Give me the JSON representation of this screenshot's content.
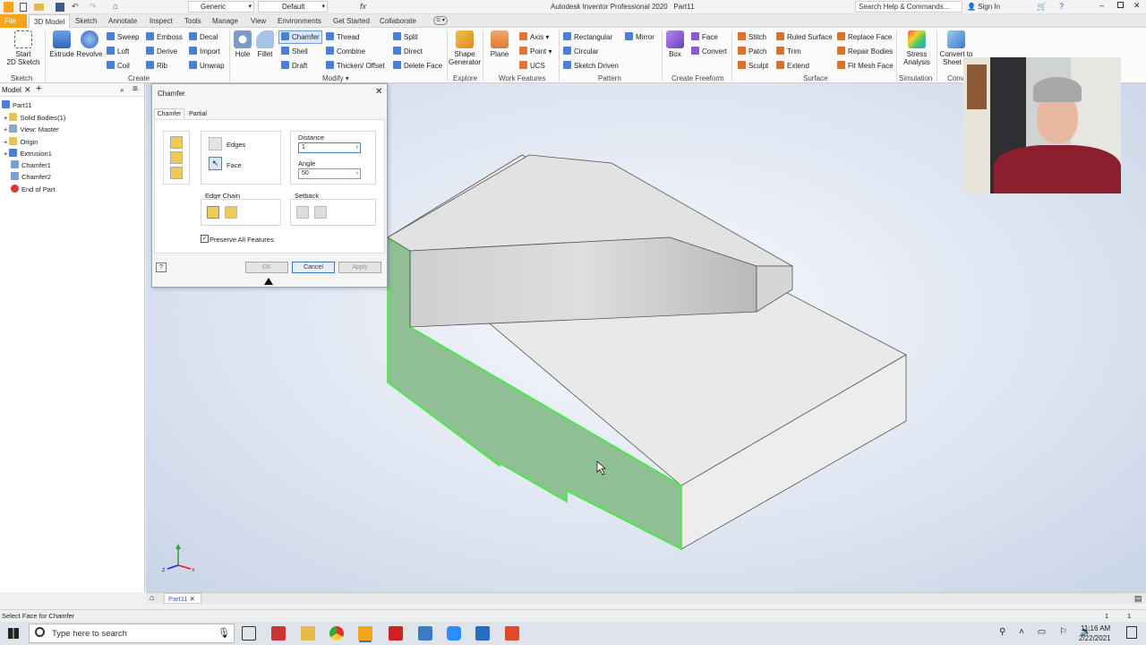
{
  "window": {
    "title": "Autodesk Inventor Professional 2020",
    "doc": "Part11",
    "material": "Generic",
    "appearance": "Default",
    "search_placeholder": "Search Help & Commands...",
    "sign_in": "Sign In"
  },
  "menu": {
    "tabs": [
      "File",
      "3D Model",
      "Sketch",
      "Annotate",
      "Inspect",
      "Tools",
      "Manage",
      "View",
      "Environments",
      "Get Started",
      "Collaborate"
    ]
  },
  "ribbon": {
    "sketch": {
      "start": "Start",
      "start2": "2D Sketch",
      "group": "Sketch"
    },
    "create": {
      "extrude": "Extrude",
      "revolve": "Revolve",
      "sweep": "Sweep",
      "loft": "Loft",
      "coil": "Coil",
      "emboss": "Emboss",
      "derive": "Derive",
      "rib": "Rib",
      "decal": "Decal",
      "import": "Import",
      "unwrap": "Unwrap",
      "group": "Create"
    },
    "modify": {
      "hole": "Hole",
      "fillet": "Fillet",
      "chamfer": "Chamfer",
      "shell": "Shell",
      "draft": "Draft",
      "thread": "Thread",
      "combine": "Combine",
      "thicken": "Thicken/ Offset",
      "split": "Split",
      "direct": "Direct",
      "delete_face": "Delete Face",
      "group": "Modify"
    },
    "explore": {
      "shape": "Shape",
      "shape2": "Generator",
      "group": "Explore"
    },
    "work": {
      "plane": "Plane",
      "axis": "Axis",
      "point": "Point",
      "ucs": "UCS",
      "group": "Work Features"
    },
    "pattern": {
      "rect": "Rectangular",
      "circ": "Circular",
      "sketch_driven": "Sketch Driven",
      "mirror": "Mirror",
      "group": "Pattern"
    },
    "freeform": {
      "box": "Box",
      "face": "Face",
      "convert": "Convert",
      "group": "Create Freeform"
    },
    "surface": {
      "stitch": "Stitch",
      "patch": "Patch",
      "sculpt": "Sculpt",
      "ruled": "Ruled Surface",
      "trim": "Trim",
      "extend": "Extend",
      "replace": "Replace Face",
      "repair": "Repair Bodies",
      "fitmesh": "Fit Mesh Face",
      "group": "Surface"
    },
    "simulation": {
      "stress": "Stress",
      "stress2": "Analysis",
      "group": "Simulation"
    },
    "convert": {
      "label": "Convert to",
      "label2": "Sheet M",
      "group": "Conv"
    }
  },
  "browser": {
    "tab": "Model",
    "items": [
      "Part11",
      "Solid Bodies(1)",
      "View: Master",
      "Origin",
      "Extrusion1",
      "Chamfer1",
      "Chamfer2",
      "End of Part"
    ]
  },
  "dialog": {
    "title": "Chamfer",
    "tabs": [
      "Chamfer",
      "Partial"
    ],
    "edges": "Edges",
    "face": "Face",
    "distance_label": "Distance",
    "distance": "1",
    "angle_label": "Angle",
    "angle": "50",
    "edge_chain": "Edge Chain",
    "setback": "Setback",
    "preserve": "Preserve All Features",
    "ok": "OK",
    "cancel": "Cancel",
    "apply": "Apply"
  },
  "doc_tab": "Part11",
  "status": {
    "text": "Select Face for Chamfer",
    "n1": "1",
    "n2": "1"
  },
  "taskbar": {
    "search": "Type here to search",
    "time": "11:16 AM",
    "date": "2/22/2021"
  },
  "colors": {
    "accent": "#f4a51c",
    "highlight_face": "#8fbf92",
    "highlight_edge": "#3ef03e"
  }
}
